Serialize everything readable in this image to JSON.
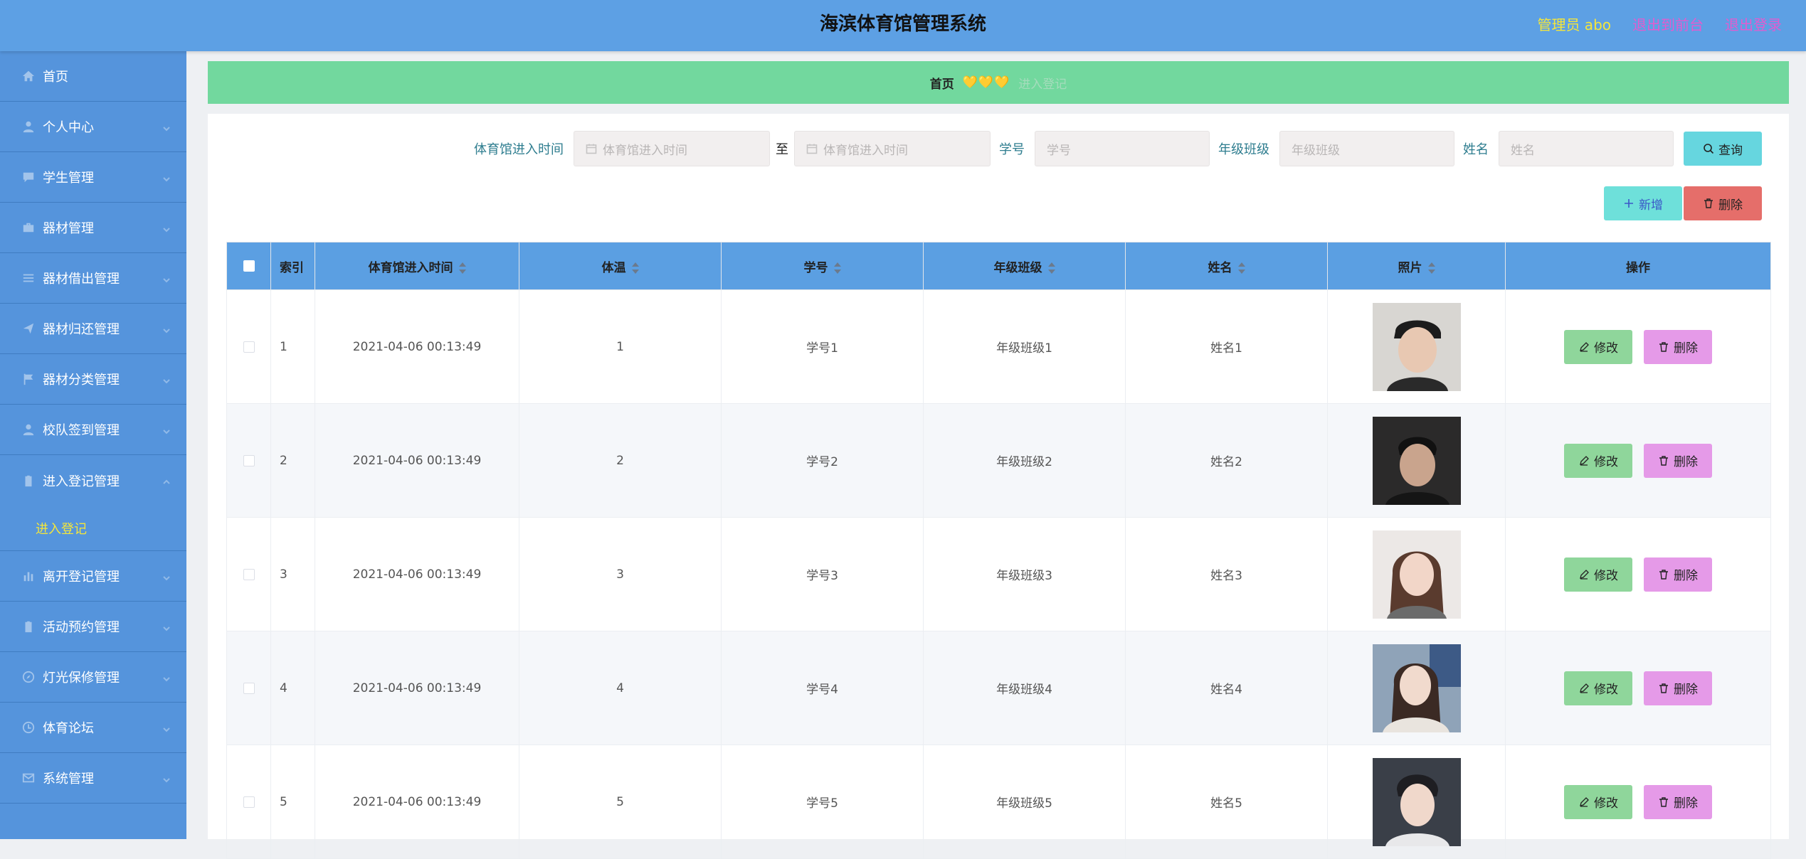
{
  "header": {
    "title": "海滨体育馆管理系统",
    "admin_label": "管理员 abo",
    "front_link": "退出到前台",
    "logout_link": "退出登录"
  },
  "sidebar": {
    "items": [
      {
        "label": "首页",
        "icon": "home-icon"
      },
      {
        "label": "个人中心",
        "icon": "user-icon"
      },
      {
        "label": "学生管理",
        "icon": "chat-icon"
      },
      {
        "label": "器材管理",
        "icon": "briefcase-icon"
      },
      {
        "label": "器材借出管理",
        "icon": "list-icon"
      },
      {
        "label": "器材归还管理",
        "icon": "send-icon"
      },
      {
        "label": "器材分类管理",
        "icon": "flag-icon"
      },
      {
        "label": "校队签到管理",
        "icon": "user-icon"
      },
      {
        "label": "进入登记管理",
        "icon": "clipboard-icon"
      },
      {
        "label": "离开登记管理",
        "icon": "bar-chart-icon"
      },
      {
        "label": "活动预约管理",
        "icon": "clipboard-icon"
      },
      {
        "label": "灯光保修管理",
        "icon": "compass-icon"
      },
      {
        "label": "体育论坛",
        "icon": "clock-icon"
      },
      {
        "label": "系统管理",
        "icon": "mail-icon"
      }
    ],
    "submenu_label": "进入登记"
  },
  "breadcrumb": {
    "home": "首页",
    "hearts": "💛💛💛",
    "current": "进入登记"
  },
  "search": {
    "time_label": "体育馆进入时间",
    "time_start_placeholder": "体育馆进入时间",
    "separator": "至",
    "time_end_placeholder": "体育馆进入时间",
    "id_label": "学号",
    "id_placeholder": "学号",
    "class_label": "年级班级",
    "class_placeholder": "年级班级",
    "name_label": "姓名",
    "name_placeholder": "姓名",
    "query_button": "查询"
  },
  "actions": {
    "add_button": "新增",
    "delete_button": "删除"
  },
  "table": {
    "columns": [
      "索引",
      "体育馆进入时间",
      "体温",
      "学号",
      "年级班级",
      "姓名",
      "照片",
      "操作"
    ],
    "edit_label": "修改",
    "delete_label": "删除",
    "rows": [
      {
        "index": "1",
        "time": "2021-04-06 00:13:49",
        "temp": "1",
        "id": "学号1",
        "class": "年级班级1",
        "name": "姓名1"
      },
      {
        "index": "2",
        "time": "2021-04-06 00:13:49",
        "temp": "2",
        "id": "学号2",
        "class": "年级班级2",
        "name": "姓名2"
      },
      {
        "index": "3",
        "time": "2021-04-06 00:13:49",
        "temp": "3",
        "id": "学号3",
        "class": "年级班级3",
        "name": "姓名3"
      },
      {
        "index": "4",
        "time": "2021-04-06 00:13:49",
        "temp": "4",
        "id": "学号4",
        "class": "年级班级4",
        "name": "姓名4"
      },
      {
        "index": "5",
        "time": "2021-04-06 00:13:49",
        "temp": "5",
        "id": "学号5",
        "class": "年级班级5",
        "name": "姓名5"
      }
    ]
  },
  "colors": {
    "header_bg": "#5da0e4",
    "sidebar_bg": "#5594dc",
    "breadcrumb_bg": "#72d89e",
    "table_header_bg": "#5b9fe2",
    "accent_yellow": "#f5e63a",
    "accent_pink": "#e25ccf"
  }
}
